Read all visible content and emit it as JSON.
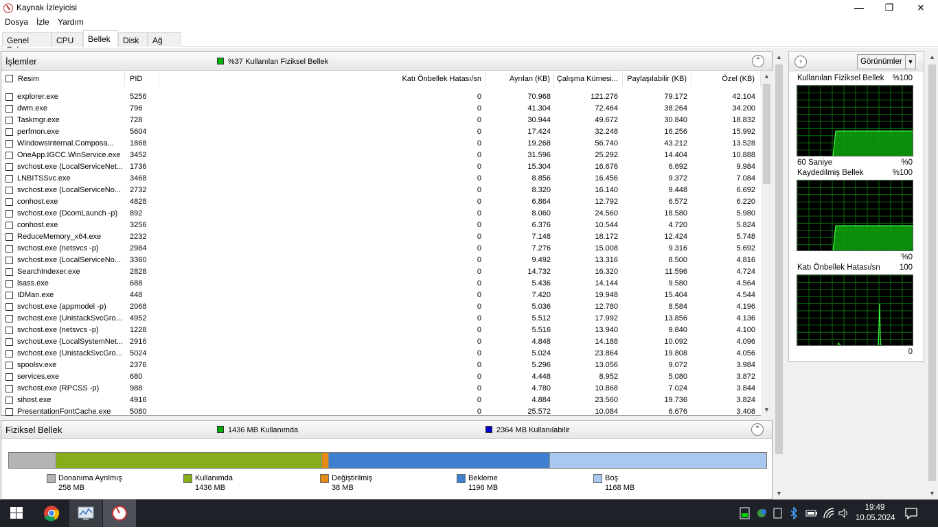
{
  "window": {
    "title": "Kaynak İzleyicisi",
    "minimize": "—",
    "maximize": "❐",
    "close": "✕"
  },
  "menu": [
    "Dosya",
    "İzle",
    "Yardım"
  ],
  "tabs": [
    "Genel Bakış",
    "CPU",
    "Bellek",
    "Disk",
    "Ağ"
  ],
  "active_tab": "Bellek",
  "processes": {
    "title": "İşlemler",
    "summary": "%37 Kullanılan Fiziksel Bellek",
    "summary_color": "#00b000",
    "columns": [
      "Resim",
      "PID",
      "Katı Önbellek Hatası/sn",
      "Ayrılan (KB)",
      "Çalışma Kümesi...",
      "Paylaşılabilir (KB)",
      "Özel (KB)"
    ],
    "rows": [
      [
        "explorer.exe",
        "5256",
        "0",
        "70.968",
        "121.276",
        "79.172",
        "42.104"
      ],
      [
        "dwm.exe",
        "796",
        "0",
        "41.304",
        "72.464",
        "38.264",
        "34.200"
      ],
      [
        "Taskmgr.exe",
        "728",
        "0",
        "30.944",
        "49.672",
        "30.840",
        "18.832"
      ],
      [
        "perfmon.exe",
        "5604",
        "0",
        "17.424",
        "32.248",
        "16.256",
        "15.992"
      ],
      [
        "WindowsInternal.Composa...",
        "1868",
        "0",
        "19.268",
        "56.740",
        "43.212",
        "13.528"
      ],
      [
        "OneApp.IGCC.WinService.exe",
        "3452",
        "0",
        "31.596",
        "25.292",
        "14.404",
        "10.888"
      ],
      [
        "svchost.exe (LocalServiceNet...",
        "1736",
        "0",
        "15.304",
        "16.676",
        "6.692",
        "9.984"
      ],
      [
        "LNBITSSvc.exe",
        "3468",
        "0",
        "8.856",
        "16.456",
        "9.372",
        "7.084"
      ],
      [
        "svchost.exe (LocalServiceNo...",
        "2732",
        "0",
        "8.320",
        "16.140",
        "9.448",
        "6.692"
      ],
      [
        "conhost.exe",
        "4828",
        "0",
        "6.864",
        "12.792",
        "6.572",
        "6.220"
      ],
      [
        "svchost.exe (DcomLaunch -p)",
        "892",
        "0",
        "8.060",
        "24.560",
        "18.580",
        "5.980"
      ],
      [
        "conhost.exe",
        "3256",
        "0",
        "6.376",
        "10.544",
        "4.720",
        "5.824"
      ],
      [
        "ReduceMemory_x64.exe",
        "2232",
        "0",
        "7.148",
        "18.172",
        "12.424",
        "5.748"
      ],
      [
        "svchost.exe (netsvcs -p)",
        "2984",
        "0",
        "7.276",
        "15.008",
        "9.316",
        "5.692"
      ],
      [
        "svchost.exe (LocalServiceNo...",
        "3360",
        "0",
        "9.492",
        "13.316",
        "8.500",
        "4.816"
      ],
      [
        "SearchIndexer.exe",
        "2828",
        "0",
        "14.732",
        "16.320",
        "11.596",
        "4.724"
      ],
      [
        "lsass.exe",
        "688",
        "0",
        "5.436",
        "14.144",
        "9.580",
        "4.564"
      ],
      [
        "IDMan.exe",
        "448",
        "0",
        "7.420",
        "19.948",
        "15.404",
        "4.544"
      ],
      [
        "svchost.exe (appmodel -p)",
        "2068",
        "0",
        "5.036",
        "12.780",
        "8.584",
        "4.196"
      ],
      [
        "svchost.exe (UnistackSvcGro...",
        "4952",
        "0",
        "5.512",
        "17.992",
        "13.856",
        "4.136"
      ],
      [
        "svchost.exe (netsvcs -p)",
        "1228",
        "0",
        "5.516",
        "13.940",
        "9.840",
        "4.100"
      ],
      [
        "svchost.exe (LocalSystemNet...",
        "2916",
        "0",
        "4.848",
        "14.188",
        "10.092",
        "4.096"
      ],
      [
        "svchost.exe (UnistackSvcGro...",
        "5024",
        "0",
        "5.024",
        "23.864",
        "19.808",
        "4.056"
      ],
      [
        "spoolsv.exe",
        "2376",
        "0",
        "5.296",
        "13.056",
        "9.072",
        "3.984"
      ],
      [
        "services.exe",
        "680",
        "0",
        "4.448",
        "8.952",
        "5.080",
        "3.872"
      ],
      [
        "svchost.exe (RPCSS -p)",
        "988",
        "0",
        "4.780",
        "10.868",
        "7.024",
        "3.844"
      ],
      [
        "sihost.exe",
        "4916",
        "0",
        "4.884",
        "23.560",
        "19.736",
        "3.824"
      ],
      [
        "PresentationFontCache.exe",
        "5080",
        "0",
        "25.572",
        "10.084",
        "6.676",
        "3.408"
      ]
    ]
  },
  "physical": {
    "title": "Fiziksel Bellek",
    "in_use": "1436 MB Kullanımda",
    "in_use_color": "#00b000",
    "available": "2364 MB Kullanılabilir",
    "available_color": "#0000cc",
    "segments": [
      {
        "label": "Donanıma Ayrılmış",
        "value": "258 MB",
        "mb": 258,
        "color": "#b4b4b4"
      },
      {
        "label": "Kullanımda",
        "value": "1436 MB",
        "mb": 1436,
        "color": "#86ae1a"
      },
      {
        "label": "Değiştirilmiş",
        "value": "38 MB",
        "mb": 38,
        "color": "#e58a14"
      },
      {
        "label": "Bekleme",
        "value": "1196 MB",
        "mb": 1196,
        "color": "#3f7fcf"
      },
      {
        "label": "Boş",
        "value": "1168 MB",
        "mb": 1168,
        "color": "#a9c7ef"
      }
    ]
  },
  "side": {
    "views_label": "Görünümler",
    "graphs": [
      {
        "title": "Kullanılan Fiziksel Bellek",
        "max": "%100",
        "footer_left": "60 Saniye",
        "footer_right": "%0"
      },
      {
        "title": "Kaydedilmiş Bellek",
        "max": "%100",
        "footer_left": "",
        "footer_right": "%0"
      },
      {
        "title": "Katı Önbellek Hatası/sn",
        "max": "100",
        "footer_left": "",
        "footer_right": "0"
      }
    ]
  },
  "taskbar": {
    "time": "19:49",
    "date": "10.05.2024"
  }
}
